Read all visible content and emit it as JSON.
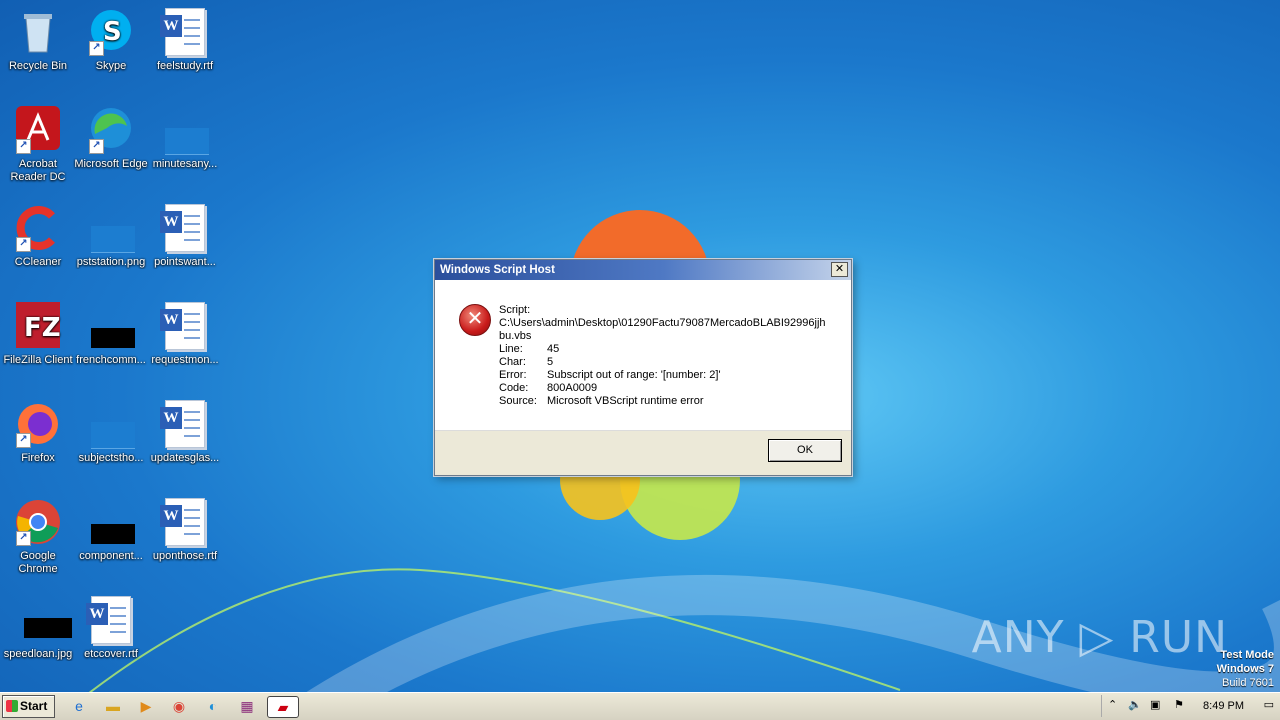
{
  "desktop": {
    "icons": [
      {
        "label": "Recycle Bin",
        "icon": "recycle-bin-icon"
      },
      {
        "label": "Skype",
        "icon": "skype-icon"
      },
      {
        "label": "feelstudy.rtf",
        "icon": "word-document-icon"
      },
      {
        "label": "Acrobat Reader DC",
        "icon": "acrobat-icon"
      },
      {
        "label": "Microsoft Edge",
        "icon": "edge-icon"
      },
      {
        "label": "minutesany...",
        "icon": "blank-file-icon"
      },
      {
        "label": "CCleaner",
        "icon": "ccleaner-icon"
      },
      {
        "label": "pststation.png",
        "icon": "image-file-icon"
      },
      {
        "label": "pointswant...",
        "icon": "word-document-icon"
      },
      {
        "label": "FileZilla Client",
        "icon": "filezilla-icon"
      },
      {
        "label": "frenchcomm...",
        "icon": "image-file-icon"
      },
      {
        "label": "requestmon...",
        "icon": "word-document-icon"
      },
      {
        "label": "Firefox",
        "icon": "firefox-icon"
      },
      {
        "label": "subjectstho...",
        "icon": "image-file-icon"
      },
      {
        "label": "updatesglas...",
        "icon": "word-document-icon"
      },
      {
        "label": "Google Chrome",
        "icon": "chrome-icon"
      },
      {
        "label": "component...",
        "icon": "image-file-icon"
      },
      {
        "label": "uponthose.rtf",
        "icon": "word-document-icon"
      },
      {
        "label": "speedloan.jpg",
        "icon": "image-file-icon"
      },
      {
        "label": "etccover.rtf",
        "icon": "word-document-icon"
      }
    ]
  },
  "dialog": {
    "title": "Windows Script Host",
    "close_glyph": "✕",
    "icon": "error-icon",
    "script_label": "Script:",
    "script_path_1": "C:\\Users\\admin\\Desktop\\01290Factu79087MercadoBLABI92996jjh",
    "script_path_2": "bu.vbs",
    "fields": [
      {
        "key": "Line:",
        "value": "45"
      },
      {
        "key": "Char:",
        "value": "5"
      },
      {
        "key": "Error:",
        "value": "Subscript out of range: '[number: 2]'"
      },
      {
        "key": "Code:",
        "value": "800A0009"
      },
      {
        "key": "Source:",
        "value": "Microsoft VBScript runtime error"
      }
    ],
    "ok_label": "OK"
  },
  "watermark": {
    "text": "ANY ▷ RUN"
  },
  "os_info": {
    "line1": "Test Mode",
    "line2": "Windows 7",
    "line3": "Build 7601"
  },
  "taskbar": {
    "start_label": "Start",
    "pinned": [
      {
        "name": "ie-icon"
      },
      {
        "name": "explorer-icon"
      },
      {
        "name": "media-player-icon"
      },
      {
        "name": "chrome-icon"
      },
      {
        "name": "edge-icon"
      },
      {
        "name": "winrar-icon"
      },
      {
        "name": "script-host-icon"
      }
    ],
    "clock": "8:49 PM"
  }
}
